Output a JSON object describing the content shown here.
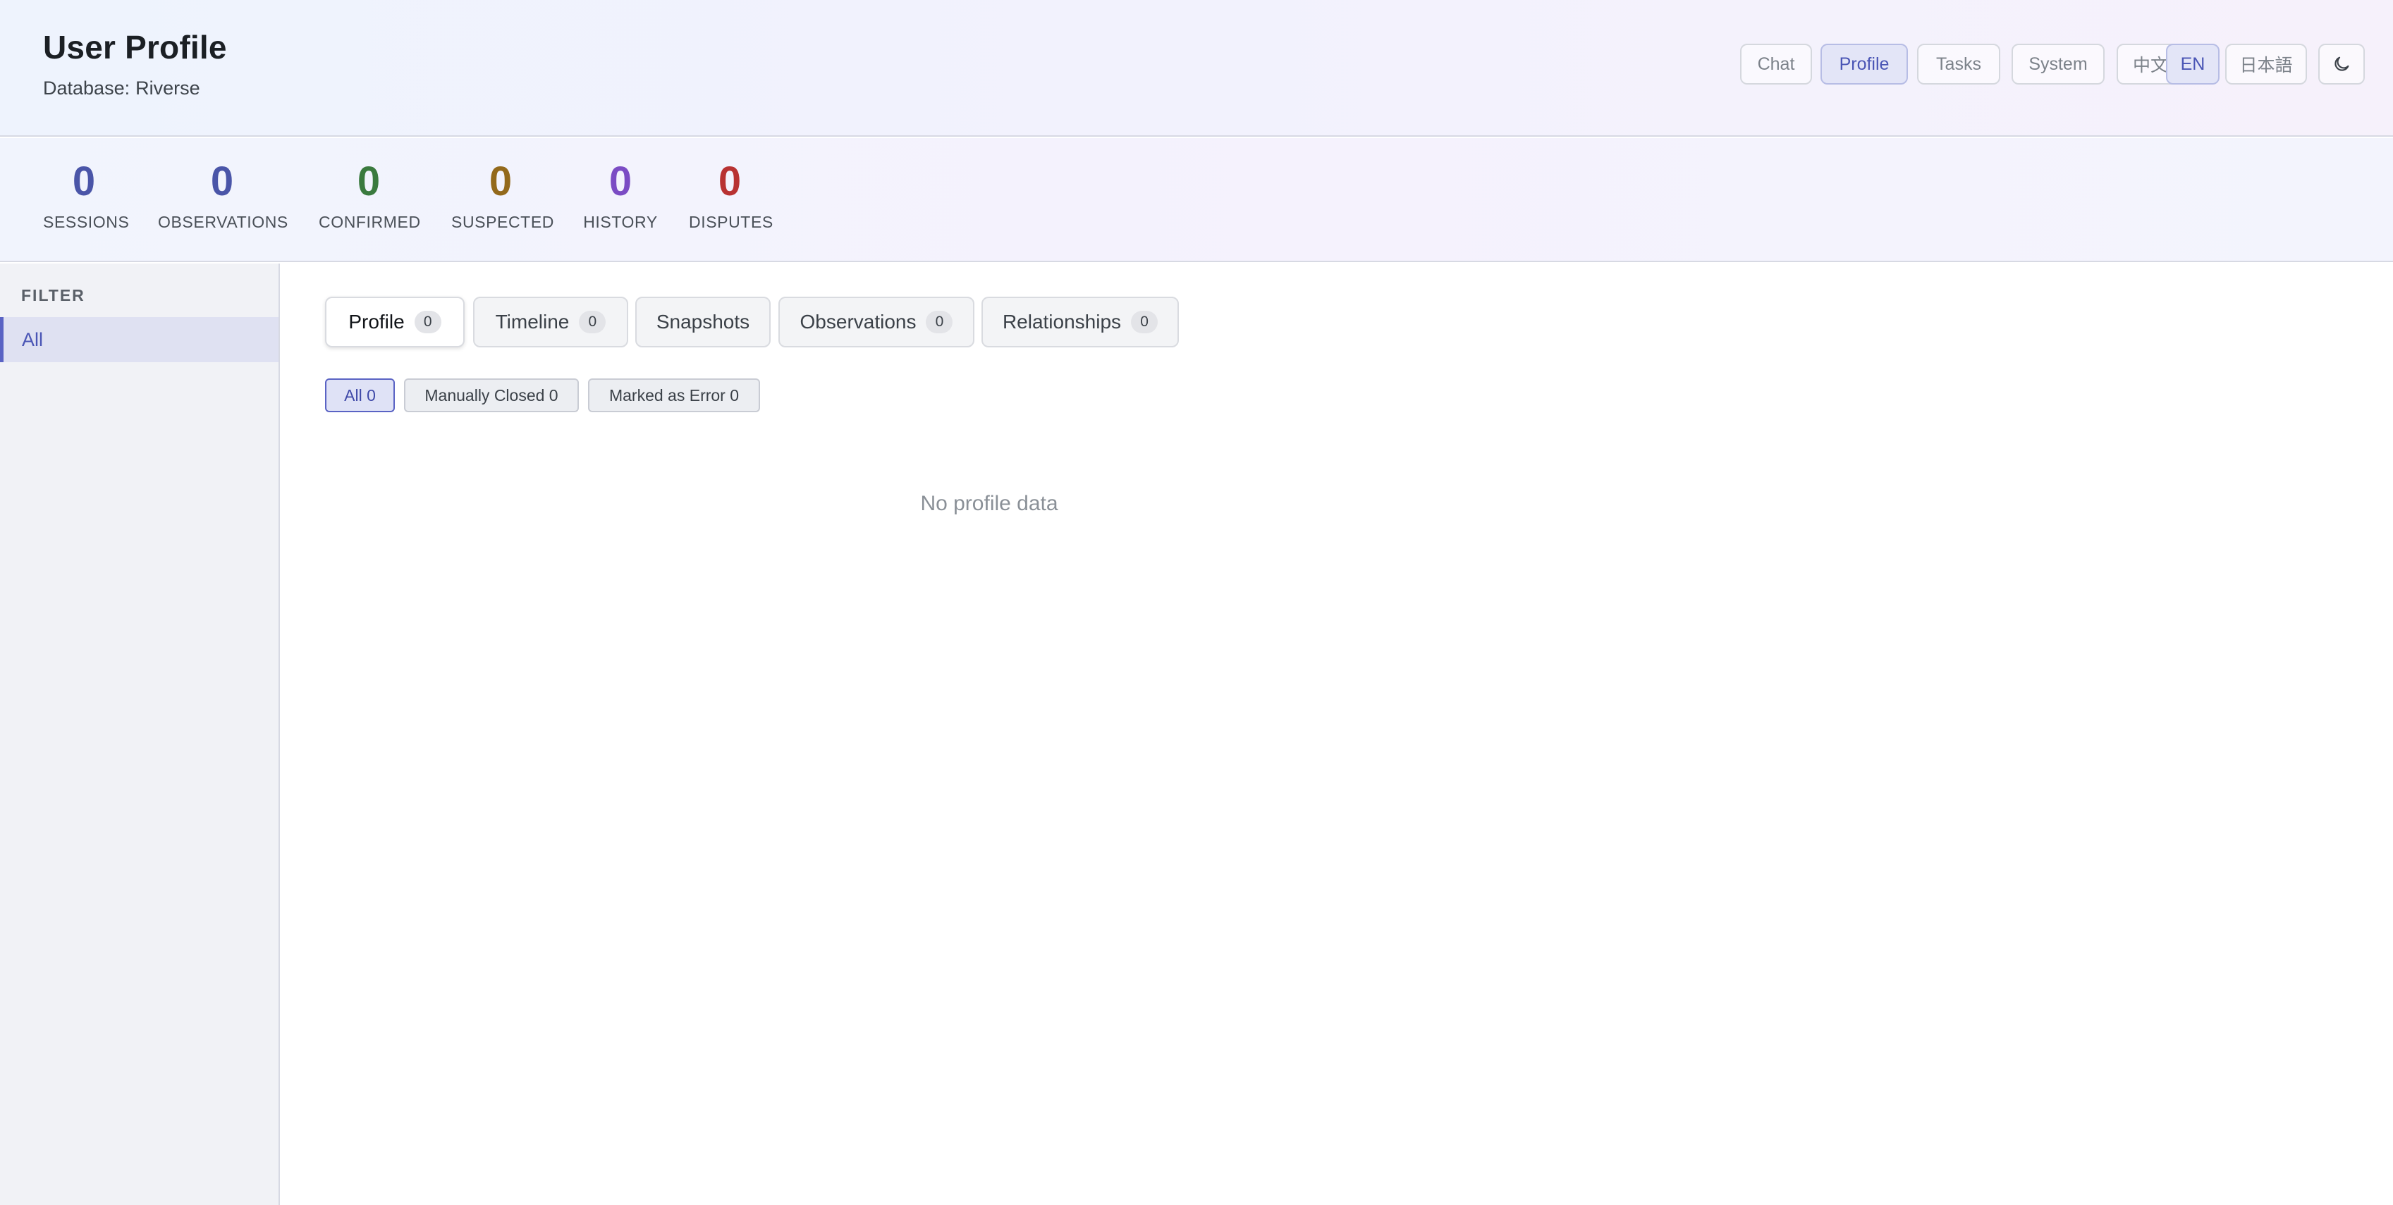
{
  "header": {
    "title": "User Profile",
    "db_label": "Database:",
    "db_name": "Riverse"
  },
  "nav": {
    "items": [
      "Chat",
      "Profile",
      "Tasks",
      "System"
    ],
    "active": "Profile",
    "languages": [
      "中文",
      "EN",
      "日本語"
    ],
    "active_language": "EN",
    "theme_icon": "moon-icon"
  },
  "stats": [
    {
      "value": "0",
      "label": "SESSIONS",
      "color": "#4a55a8"
    },
    {
      "value": "0",
      "label": "OBSERVATIONS",
      "color": "#4a55a8"
    },
    {
      "value": "0",
      "label": "CONFIRMED",
      "color": "#3a7a3e"
    },
    {
      "value": "0",
      "label": "SUSPECTED",
      "color": "#93691b"
    },
    {
      "value": "0",
      "label": "HISTORY",
      "color": "#7b4cc4"
    },
    {
      "value": "0",
      "label": "DISPUTES",
      "color": "#b83232"
    }
  ],
  "sidebar": {
    "title": "FILTER",
    "items": [
      "All"
    ]
  },
  "tabs": [
    {
      "label": "Profile",
      "count": "0"
    },
    {
      "label": "Timeline",
      "count": "0"
    },
    {
      "label": "Snapshots"
    },
    {
      "label": "Observations",
      "count": "0"
    },
    {
      "label": "Relationships",
      "count": "0"
    }
  ],
  "chips": [
    {
      "label": "All 0"
    },
    {
      "label": "Manually Closed 0"
    },
    {
      "label": "Marked as Error 0"
    }
  ],
  "empty_message": "No profile data",
  "colors": {
    "accent": "#4a55b5",
    "accent_bg": "#e3e5f7"
  }
}
